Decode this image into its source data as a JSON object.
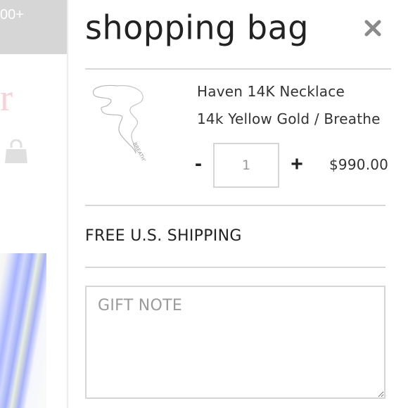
{
  "background_page": {
    "banner_text": "00+",
    "logo_fragment": "r"
  },
  "drawer": {
    "title": "shopping bag",
    "close_icon": "close-icon"
  },
  "cart_item": {
    "name": "Haven 14K Necklace",
    "variant": "14k Yellow Gold / Breathe",
    "quantity": "1",
    "decrement_label": "-",
    "increment_label": "+",
    "price": "$990.00",
    "thumbnail_engraving": "BREATHE"
  },
  "shipping": {
    "label": "FREE U.S. SHIPPING"
  },
  "gift_note": {
    "placeholder": "GIFT NOTE",
    "value": ""
  },
  "colors": {
    "banner": "#c9c9c9",
    "logo_pink": "#f2c3ce",
    "divider": "#d8d8d8",
    "border": "#d6d6d6"
  }
}
